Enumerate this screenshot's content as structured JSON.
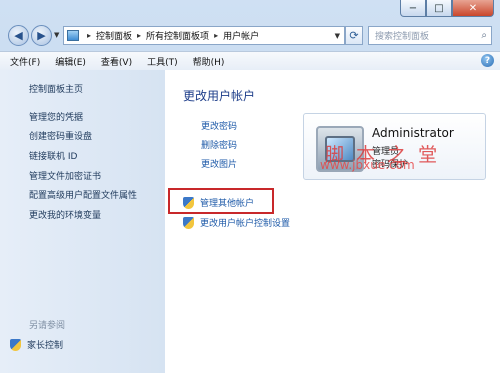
{
  "titlebar": {
    "min": "−",
    "max": "□",
    "close": "✕"
  },
  "address": {
    "segments": [
      "控制面板",
      "所有控制面板项",
      "用户帐户"
    ],
    "search_placeholder": "搜索控制面板"
  },
  "menu": [
    "文件(F)",
    "编辑(E)",
    "查看(V)",
    "工具(T)",
    "帮助(H)"
  ],
  "sidebar": {
    "home": "控制面板主页",
    "items": [
      "管理您的凭据",
      "创建密码重设盘",
      "链接联机 ID",
      "管理文件加密证书",
      "配置高级用户配置文件属性",
      "更改我的环境变量"
    ],
    "see_also": "另请参阅",
    "family_safety": "家长控制"
  },
  "main": {
    "heading": "更改用户帐户",
    "links": [
      "更改密码",
      "删除密码",
      "更改图片"
    ],
    "manage_other": "管理其他帐户",
    "uac": "更改用户帐户控制设置"
  },
  "user": {
    "name": "Administrator",
    "role": "管理员",
    "protected": "密码保护"
  },
  "watermark": {
    "text": "脚 本 之 堂",
    "url": "www.jbxue.com"
  },
  "colors": {
    "link": "#1e5aa8",
    "highlight_box": "#c8282a"
  }
}
